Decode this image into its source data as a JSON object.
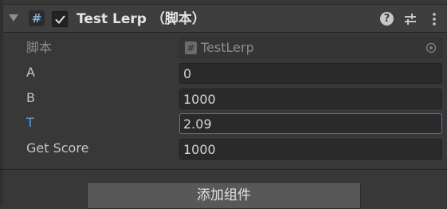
{
  "component": {
    "title": "Test Lerp （脚本）",
    "script_icon_glyph": "#",
    "enabled": true,
    "icons": [
      "help-icon",
      "presets-icon",
      "more-options-icon"
    ]
  },
  "properties": [
    {
      "label": "脚本",
      "kind": "object",
      "value": "TestLerp",
      "readonly": true
    },
    {
      "label": "A",
      "kind": "float",
      "value": "0"
    },
    {
      "label": "B",
      "kind": "float",
      "value": "1000"
    },
    {
      "label": "T",
      "kind": "float",
      "value": "2.09",
      "focused": true
    },
    {
      "label": "Get Score",
      "kind": "float",
      "value": "1000"
    }
  ],
  "add_component_label": "添加组件",
  "colors": {
    "background": "#383838",
    "header": "#3e3e3e",
    "field": "#2a2a2a",
    "focus_border": "#3c78c8",
    "focused_label": "#5d97dc"
  }
}
